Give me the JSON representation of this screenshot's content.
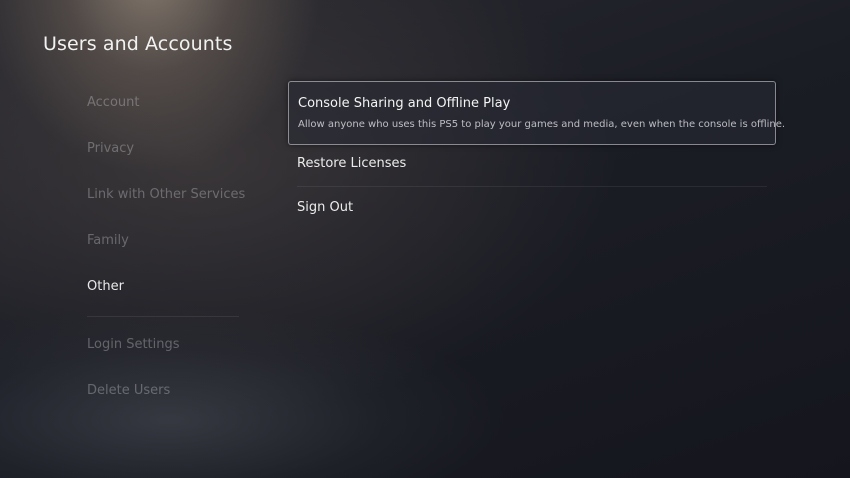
{
  "header": {
    "title": "Users and Accounts"
  },
  "sidebar": {
    "items": [
      {
        "label": "Account",
        "active": false
      },
      {
        "label": "Privacy",
        "active": false
      },
      {
        "label": "Link with Other Services",
        "active": false
      },
      {
        "label": "Family",
        "active": false
      },
      {
        "label": "Other",
        "active": true
      }
    ],
    "secondary_items": [
      {
        "label": "Login Settings"
      },
      {
        "label": "Delete Users"
      }
    ]
  },
  "main": {
    "options": [
      {
        "title": "Console Sharing and Offline Play",
        "description": "Allow anyone who uses this PS5 to play your games and media, even when the console is offline.",
        "focused": true
      },
      {
        "title": "Restore Licenses",
        "focused": false
      },
      {
        "title": "Sign Out",
        "focused": false
      }
    ]
  },
  "colors": {
    "text_primary": "#ffffff",
    "text_dim": "#6f6f75",
    "focus_border": "#d8d8dc",
    "background_dark": "#15161d"
  }
}
